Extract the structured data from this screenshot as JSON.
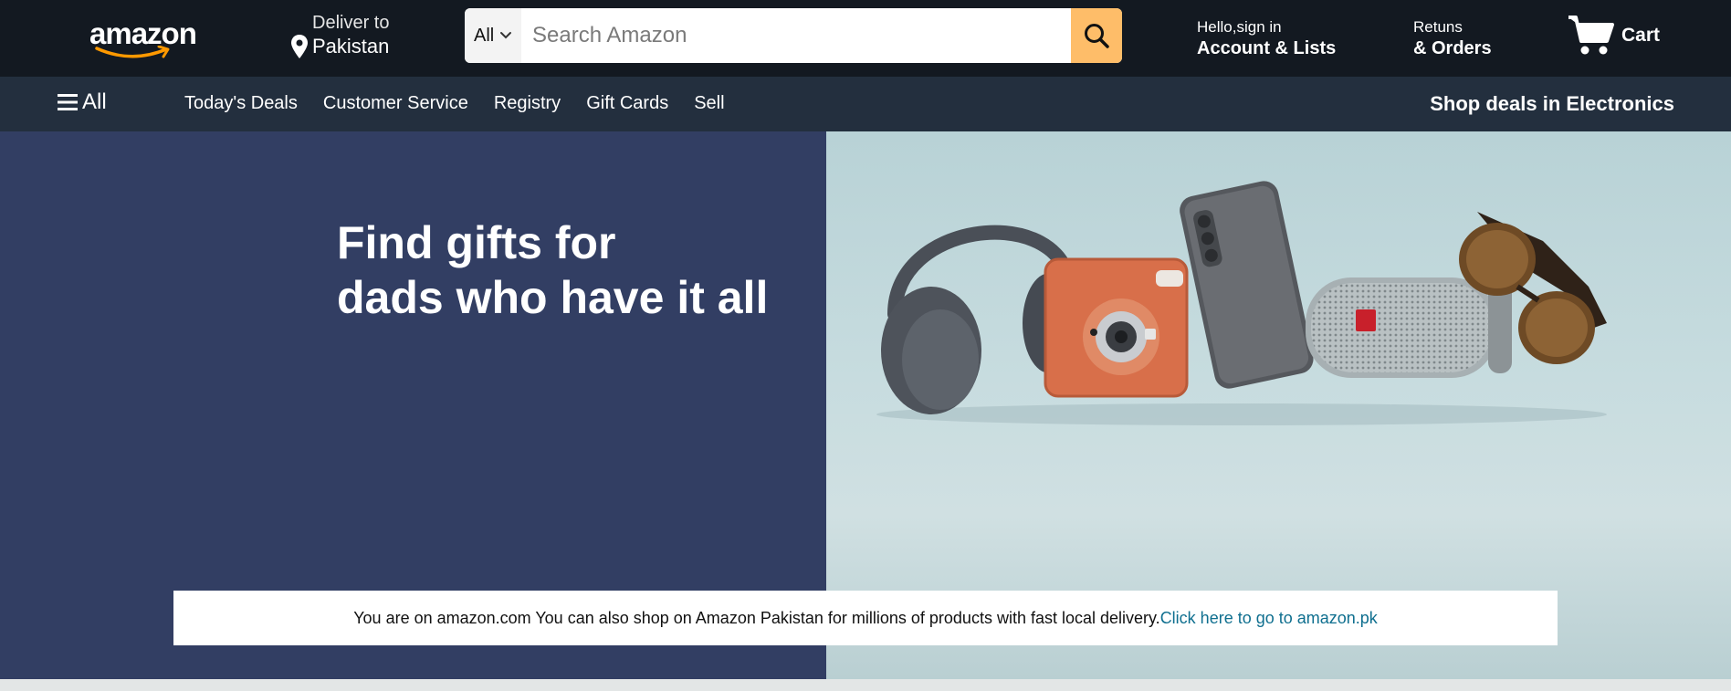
{
  "header": {
    "logo_text": "amazon",
    "deliver_label": "Deliver to",
    "deliver_location": "Pakistan",
    "search": {
      "category": "All",
      "placeholder": "Search Amazon"
    },
    "account_line1": "Hello,sign in",
    "account_line2": "Account & Lists",
    "orders_line1": "Retuns",
    "orders_line2": "& Orders",
    "cart_label": "Cart"
  },
  "subnav": {
    "all_label": "All",
    "links": [
      "Today's Deals",
      "Customer Service",
      "Registry",
      "Gift Cards",
      "Sell"
    ],
    "promo": "Shop deals in Electronics"
  },
  "hero": {
    "title_line1": "Find gifts for",
    "title_line2": "dads who have it all"
  },
  "notice": {
    "text": "You are on amazon.com You can also shop on Amazon Pakistan for millions of products with fast local delivery.",
    "link": "Click here to go to amazon.pk"
  },
  "colors": {
    "topbar": "#131921",
    "subnav": "#232f3e",
    "search_button": "#febd69",
    "hero_left": "#323e63",
    "logo_smile": "#ff9900",
    "link": "#0f6f8f"
  },
  "icons": [
    "map-pin-icon",
    "chevron-down-icon",
    "search-icon",
    "cart-icon",
    "hamburger-icon"
  ]
}
